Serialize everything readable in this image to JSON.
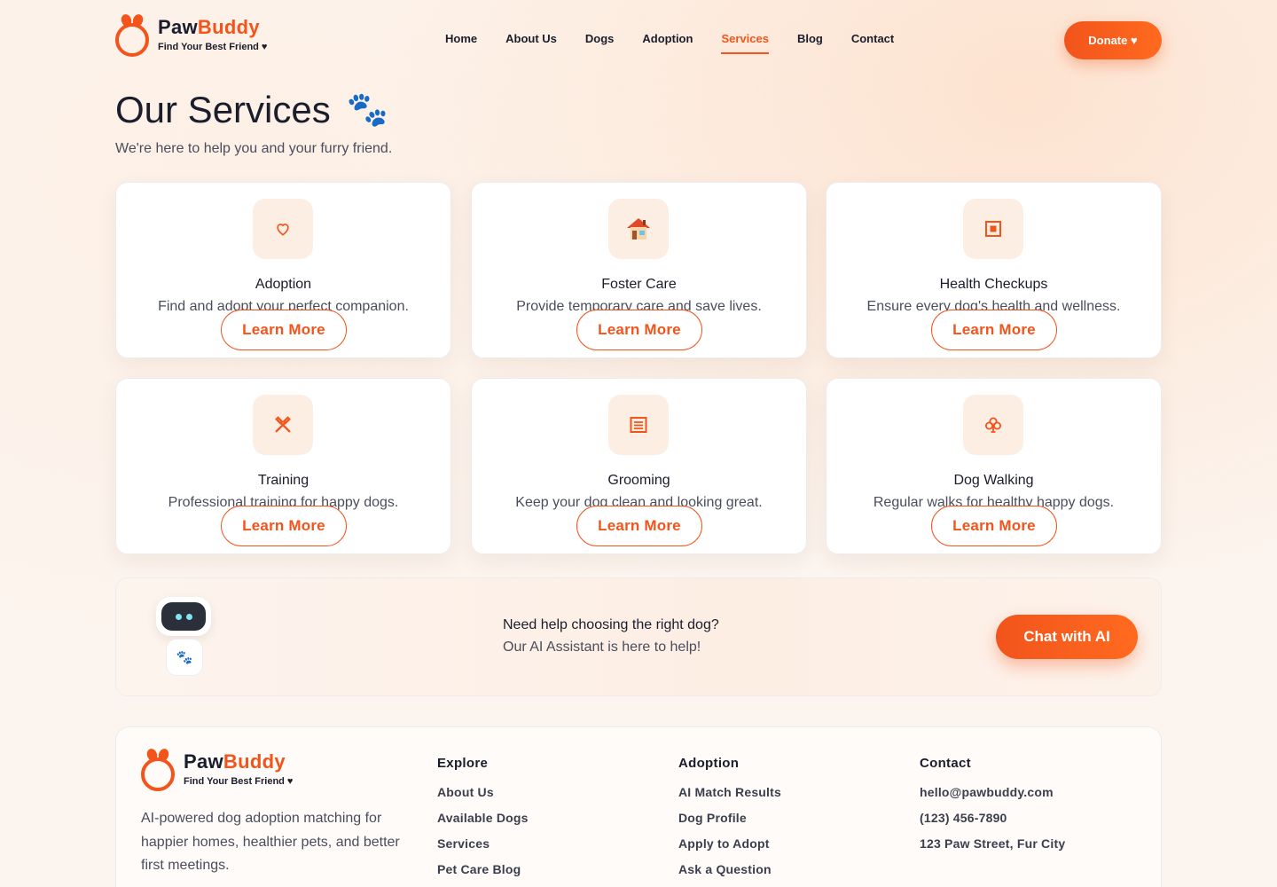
{
  "brand": {
    "name_part1": "Paw",
    "name_part2": "Buddy",
    "tagline": "Find Your Best Friend ♥",
    "accent_color": "#f2541b"
  },
  "nav": {
    "items": [
      {
        "label": "Home",
        "active": false
      },
      {
        "label": "About Us",
        "active": false
      },
      {
        "label": "Dogs",
        "active": false
      },
      {
        "label": "Adoption",
        "active": false
      },
      {
        "label": "Services",
        "active": true
      },
      {
        "label": "Blog",
        "active": false
      },
      {
        "label": "Contact",
        "active": false
      }
    ],
    "donate_label": "Donate ♥"
  },
  "page": {
    "title": "Our Services",
    "title_icon": "paw-icon",
    "subtitle": "We're here to help you and your furry friend."
  },
  "services": [
    {
      "title": "Adoption",
      "desc": "Find and adopt your perfect companion.",
      "icon": "heart-icon",
      "cta": "Learn More"
    },
    {
      "title": "Foster Care",
      "desc": "Provide temporary care and save lives.",
      "icon": "house-icon",
      "cta": "Learn More"
    },
    {
      "title": "Health Checkups",
      "desc": "Ensure every dog's health and wellness.",
      "icon": "medical-box-icon",
      "cta": "Learn More"
    },
    {
      "title": "Training",
      "desc": "Professional training for happy dogs.",
      "icon": "tools-icon",
      "cta": "Learn More"
    },
    {
      "title": "Grooming",
      "desc": "Keep your dog clean and looking great.",
      "icon": "list-icon",
      "cta": "Learn More"
    },
    {
      "title": "Dog Walking",
      "desc": "Regular walks for healthy happy dogs.",
      "icon": "club-icon",
      "cta": "Learn More"
    }
  ],
  "ai_banner": {
    "question": "Need help choosing the right dog?",
    "answer": "Our AI Assistant is here to help!",
    "cta": "Chat with AI"
  },
  "footer": {
    "description": "AI-powered dog adoption matching for happier homes, healthier pets, and better first meetings.",
    "columns": [
      {
        "title": "Explore",
        "links": [
          "About Us",
          "Available Dogs",
          "Services",
          "Pet Care Blog"
        ]
      },
      {
        "title": "Adoption",
        "links": [
          "AI Match Results",
          "Dog Profile",
          "Apply to Adopt",
          "Ask a Question"
        ]
      },
      {
        "title": "Contact",
        "links": [
          "hello@pawbuddy.com",
          "(123) 456-7890",
          "123 Paw Street, Fur City"
        ]
      }
    ]
  }
}
